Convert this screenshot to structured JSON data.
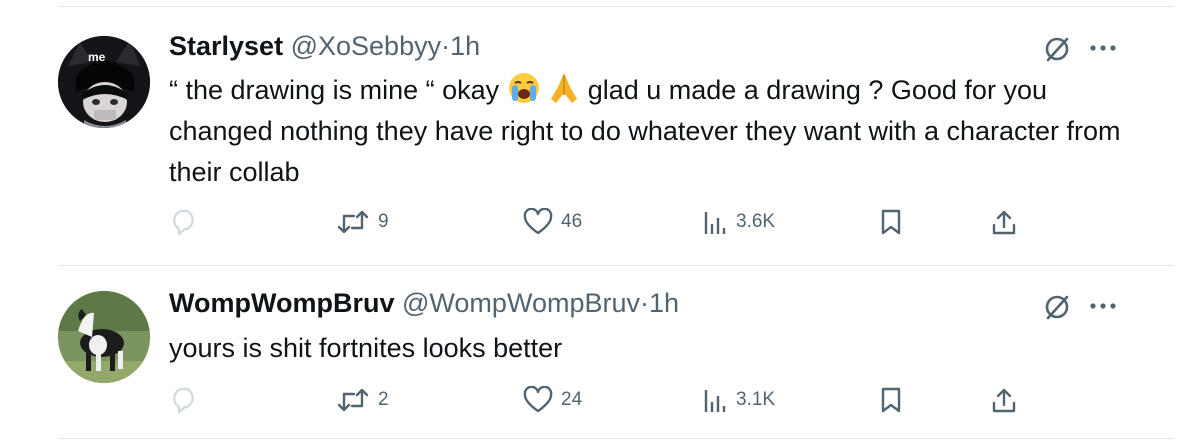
{
  "tweets": [
    {
      "name": "Starlyset",
      "handle": "@XoSebbyy",
      "dot": "·",
      "time": "1h",
      "avatar_text": "me",
      "text_before": "“ the drawing is mine “ okay",
      "text_after": "glad u made a drawing ? Good for you changed nothing they have right to do whatever they want with a character from their collab",
      "emojis": [
        "loudly-crying-face",
        "folded-hands"
      ],
      "retweets": "9",
      "likes": "46",
      "views": "3.6K"
    },
    {
      "name": "WompWompBruv",
      "handle": "@WompWompBruv",
      "dot": "·",
      "time": "1h",
      "text": "yours is shit fortnites looks better",
      "retweets": "2",
      "likes": "24",
      "views": "3.1K"
    }
  ],
  "colors": {
    "text": "#0f1419",
    "secondary": "#536471",
    "separator": "#e3e6e8"
  }
}
